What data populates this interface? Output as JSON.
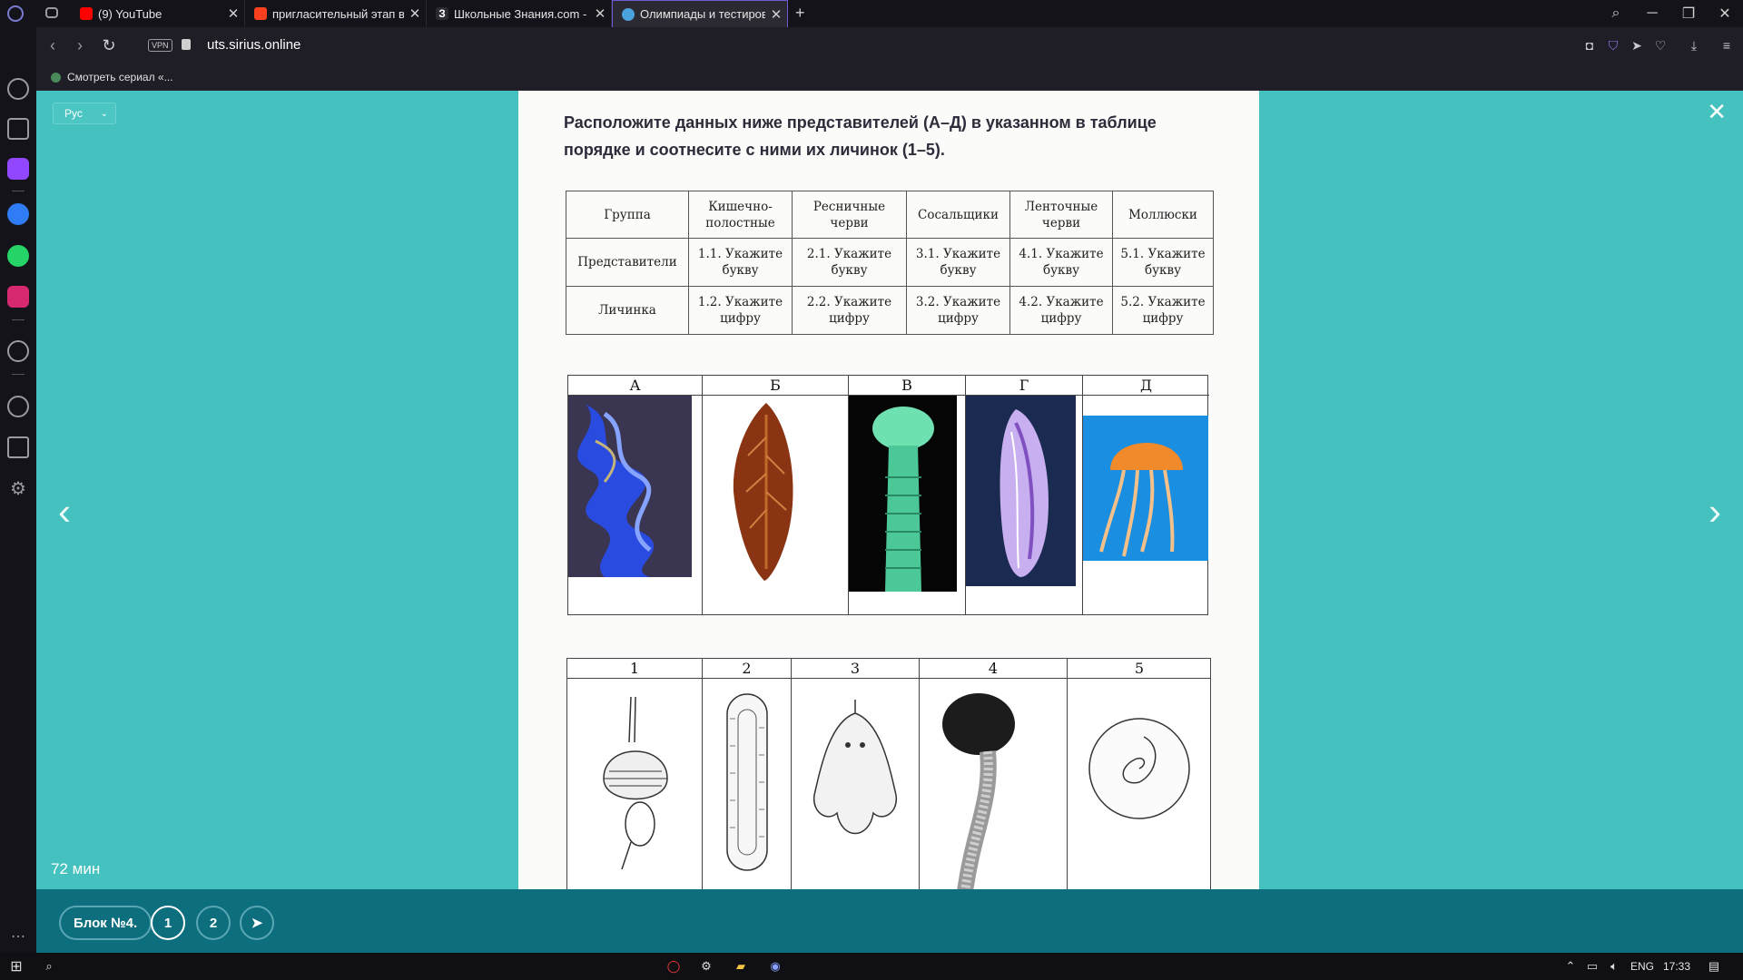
{
  "browser": {
    "tabs": [
      {
        "title": "(9) YouTube",
        "color": "#ff0000"
      },
      {
        "title": "пригласительный этап вс",
        "color": "#fc3f1d"
      },
      {
        "title": "Школьные Знания.com - Р",
        "color": "#ffffff"
      },
      {
        "title": "Олимпиады и тестирован",
        "color": "#4aa3df"
      }
    ],
    "new_tab_icon": "+",
    "vpn_label": "VPN",
    "url": "uts.sirius.online",
    "bookmark": "Смотреть сериал «..."
  },
  "page": {
    "language": "Рус",
    "question": "Расположите данных ниже представителей (А–Д) в указанном в таблице порядке и соотнесите с ними их личинок (1–5).",
    "timer": "72 мин",
    "table": {
      "header": [
        "Группа",
        "Кишечно-полостные",
        "Ресничные черви",
        "Сосальщики",
        "Ленточные черви",
        "Моллюски"
      ],
      "rows": [
        [
          "Представители",
          "1.1. Укажите букву",
          "2.1. Укажите букву",
          "3.1. Укажите букву",
          "4.1. Укажите букву",
          "5.1. Укажите букву"
        ],
        [
          "Личинка",
          "1.2. Укажите цифру",
          "2.2. Укажите цифру",
          "3.2. Укажите цифру",
          "4.2. Укажите цифру",
          "5.2. Укажите цифру"
        ]
      ]
    },
    "adults_labels": [
      "А",
      "Б",
      "В",
      "Г",
      "Д"
    ],
    "larvae_labels": [
      "1",
      "2",
      "3",
      "4",
      "5"
    ]
  },
  "bottom": {
    "block_label": "Блок №4.",
    "pages": [
      "1",
      "2"
    ],
    "current_page": "1"
  },
  "taskbar": {
    "lang": "ENG",
    "time": "17:33"
  }
}
